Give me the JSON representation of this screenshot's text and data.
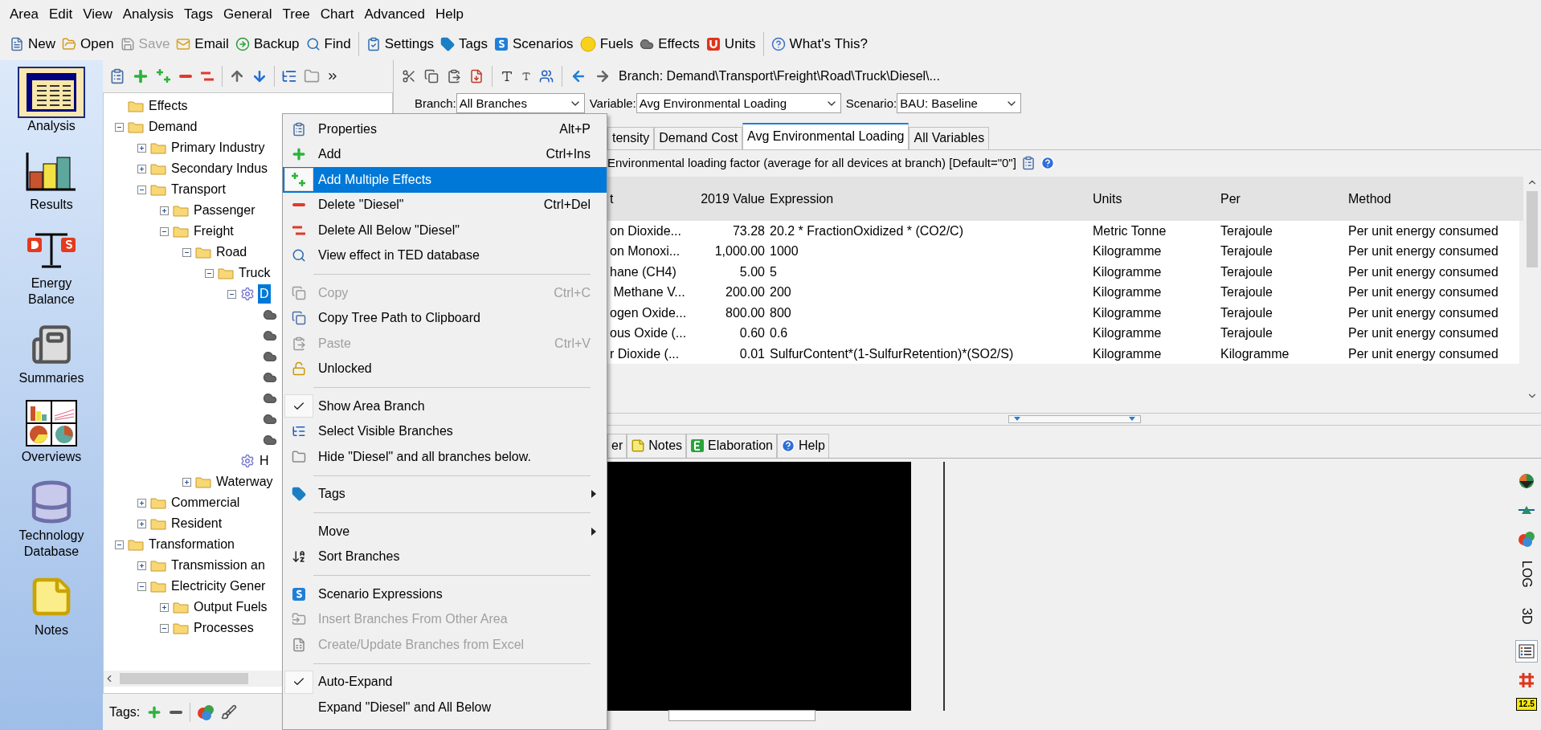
{
  "menu_bar": [
    "Area",
    "Edit",
    "View",
    "Analysis",
    "Tags",
    "General",
    "Tree",
    "Chart",
    "Advanced",
    "Help"
  ],
  "toolbar_groups": [
    [
      {
        "label": "New",
        "disabled": false
      },
      {
        "label": "Open",
        "disabled": false
      },
      {
        "label": "Save",
        "disabled": true
      },
      {
        "label": "Email",
        "disabled": false
      },
      {
        "label": "Backup",
        "disabled": false
      },
      {
        "label": "Find",
        "disabled": false
      }
    ],
    [
      {
        "label": "Settings",
        "disabled": false
      },
      {
        "label": "Tags",
        "disabled": false
      },
      {
        "label": "Scenarios",
        "disabled": false
      },
      {
        "label": "Fuels",
        "disabled": false
      },
      {
        "label": "Effects",
        "disabled": false
      },
      {
        "label": "Units",
        "disabled": false
      }
    ],
    [
      {
        "label": "What's This?",
        "disabled": false
      }
    ]
  ],
  "nav": [
    {
      "label": "Analysis",
      "selected": true
    },
    {
      "label": "Results",
      "selected": false
    },
    {
      "label": "Energy Balance",
      "selected": false
    },
    {
      "label": "Summaries",
      "selected": false
    },
    {
      "label": "Overviews",
      "selected": false
    },
    {
      "label": "Technology Database",
      "selected": false
    },
    {
      "label": "Notes",
      "selected": false
    }
  ],
  "tree": [
    {
      "kind": "folder",
      "label": "Effects",
      "selected": false
    },
    {
      "kind": "folder",
      "label": "Demand",
      "selected": false,
      "expanded": true,
      "children": [
        {
          "kind": "folder",
          "label": "Primary Industry",
          "selected": false,
          "expanded": false
        },
        {
          "kind": "folder",
          "label": "Secondary Indus",
          "selected": false,
          "expanded": false
        },
        {
          "kind": "folder",
          "label": "Transport",
          "selected": false,
          "expanded": true,
          "children": [
            {
              "kind": "folder",
              "label": "Passenger",
              "selected": false,
              "expanded": false
            },
            {
              "kind": "folder",
              "label": "Freight",
              "selected": false,
              "expanded": true,
              "children": [
                {
                  "kind": "folder",
                  "label": "Road",
                  "selected": false,
                  "expanded": true,
                  "children": [
                    {
                      "kind": "folder",
                      "label": "Truck",
                      "selected": false,
                      "expanded": true,
                      "children": [
                        {
                          "kind": "technology",
                          "label": "D",
                          "selected": true,
                          "expanded": true,
                          "children": [
                            {
                              "kind": "effect",
                              "selected": false
                            },
                            {
                              "kind": "effect",
                              "selected": false
                            },
                            {
                              "kind": "effect",
                              "selected": false
                            },
                            {
                              "kind": "effect",
                              "selected": false
                            },
                            {
                              "kind": "effect",
                              "selected": false
                            },
                            {
                              "kind": "effect",
                              "selected": false
                            },
                            {
                              "kind": "effect",
                              "selected": false
                            }
                          ]
                        },
                        {
                          "kind": "technology",
                          "label": "H",
                          "selected": false
                        }
                      ]
                    }
                  ]
                },
                {
                  "kind": "folder",
                  "label": "Waterway",
                  "selected": false,
                  "expanded": false
                }
              ]
            }
          ]
        },
        {
          "kind": "folder",
          "label": "Commercial",
          "selected": false,
          "expanded": false
        },
        {
          "kind": "folder",
          "label": "Resident",
          "selected": false,
          "expanded": false
        }
      ]
    },
    {
      "kind": "folder",
      "label": "Transformation",
      "selected": false,
      "expanded": true,
      "children": [
        {
          "kind": "folder",
          "label": "Transmission an",
          "selected": false,
          "expanded": false
        },
        {
          "kind": "folder",
          "label": "Electricity Gener",
          "selected": false,
          "expanded": true,
          "children": [
            {
              "kind": "folder",
              "label": "Output Fuels",
              "selected": false,
              "expanded": false
            },
            {
              "kind": "folder",
              "label": "Processes",
              "selected": false,
              "expanded": true
            }
          ]
        }
      ]
    }
  ],
  "tree_tags_label": "Tags:",
  "context_menu": [
    {
      "kind": "item",
      "label": "Properties",
      "shortcut": "Alt+P",
      "selected": false,
      "disabled": false,
      "checked": false
    },
    {
      "kind": "item",
      "label": "Add",
      "shortcut": "Ctrl+Ins",
      "selected": false,
      "disabled": false,
      "checked": false
    },
    {
      "kind": "item",
      "label": "Add Multiple Effects",
      "selected": true,
      "disabled": false,
      "checked": false
    },
    {
      "kind": "item",
      "label": "Delete \"Diesel\"",
      "shortcut": "Ctrl+Del",
      "selected": false,
      "disabled": false,
      "checked": false
    },
    {
      "kind": "item",
      "label": "Delete All Below \"Diesel\"",
      "selected": false,
      "disabled": false,
      "checked": false
    },
    {
      "kind": "item",
      "label": "View effect in TED database",
      "selected": false,
      "disabled": false,
      "checked": false
    },
    {
      "kind": "separator"
    },
    {
      "kind": "item",
      "label": "Copy",
      "shortcut": "Ctrl+C",
      "selected": false,
      "disabled": true,
      "checked": false
    },
    {
      "kind": "item",
      "label": "Copy Tree Path to Clipboard",
      "selected": false,
      "disabled": false,
      "checked": false
    },
    {
      "kind": "item",
      "label": "Paste",
      "shortcut": "Ctrl+V",
      "selected": false,
      "disabled": true,
      "checked": false
    },
    {
      "kind": "item",
      "label": "Unlocked",
      "selected": false,
      "disabled": false,
      "checked": false
    },
    {
      "kind": "separator"
    },
    {
      "kind": "item",
      "label": "Show Area Branch",
      "selected": false,
      "disabled": false,
      "checked": true
    },
    {
      "kind": "item",
      "label": "Select Visible Branches",
      "selected": false,
      "disabled": false,
      "checked": false
    },
    {
      "kind": "item",
      "label": "Hide \"Diesel\" and all branches below.",
      "selected": false,
      "disabled": false,
      "checked": false
    },
    {
      "kind": "separator"
    },
    {
      "kind": "submenu",
      "label": "Tags",
      "selected": false,
      "disabled": false,
      "checked": false
    },
    {
      "kind": "separator"
    },
    {
      "kind": "submenu",
      "label": "Move",
      "selected": false,
      "disabled": false,
      "checked": false
    },
    {
      "kind": "item",
      "label": "Sort Branches",
      "selected": false,
      "disabled": false,
      "checked": false
    },
    {
      "kind": "separator"
    },
    {
      "kind": "item",
      "label": "Scenario Expressions",
      "selected": false,
      "disabled": false,
      "checked": false
    },
    {
      "kind": "item",
      "label": "Insert Branches From Other Area",
      "selected": false,
      "disabled": true,
      "checked": false
    },
    {
      "kind": "item",
      "label": "Create/Update Branches from Excel",
      "selected": false,
      "disabled": true,
      "checked": false
    },
    {
      "kind": "separator"
    },
    {
      "kind": "item",
      "label": "Auto-Expand",
      "selected": false,
      "disabled": false,
      "checked": true
    },
    {
      "kind": "item",
      "label": "Expand \"Diesel\" and All Below",
      "selected": false,
      "disabled": false,
      "checked": false
    }
  ],
  "branch_path": "Branch: Demand\\Transport\\Freight\\Road\\Truck\\Diesel\\...",
  "selectors": [
    {
      "label": "Branch:",
      "value": "All Branches"
    },
    {
      "label": "Variable:",
      "value": "Avg Environmental Loading"
    },
    {
      "label": "Scenario:",
      "value": "BAU: Baseline"
    }
  ],
  "variable_tabs": [
    {
      "label": "tensity",
      "selected": false
    },
    {
      "label": "Demand Cost",
      "selected": false
    },
    {
      "label": "Avg Environmental Loading",
      "selected": true
    },
    {
      "label": "All Variables",
      "selected": false
    }
  ],
  "description": "Environmental loading factor (average for all devices at branch) [Default=\"0\"]",
  "table": {
    "columns": [
      "t",
      "2019 Value",
      "Expression",
      "Units",
      "Per",
      "Method"
    ],
    "rows": [
      [
        "on Dioxide...",
        "73.28",
        "20.2 * FractionOxidized * (CO2/C)",
        "Metric Tonne",
        "Terajoule",
        "Per unit energy consumed"
      ],
      [
        "on Monoxi...",
        "1,000.00",
        "1000",
        "Kilogramme",
        "Terajoule",
        "Per unit energy consumed"
      ],
      [
        "hane (CH4)",
        "5.00",
        "5",
        "Kilogramme",
        "Terajoule",
        "Per unit energy consumed"
      ],
      [
        " Methane V...",
        "200.00",
        "200",
        "Kilogramme",
        "Terajoule",
        "Per unit energy consumed"
      ],
      [
        "ogen Oxide...",
        "800.00",
        "800",
        "Kilogramme",
        "Terajoule",
        "Per unit energy consumed"
      ],
      [
        "ous Oxide (...",
        "0.60",
        "0.6",
        "Kilogramme",
        "Terajoule",
        "Per unit energy consumed"
      ],
      [
        "r Dioxide (...",
        "0.01",
        "SulfurContent*(1-SulfurRetention)*(SO2/S)",
        "Kilogramme",
        "Kilogramme",
        "Per unit energy consumed"
      ]
    ]
  },
  "bottom_tabs": [
    {
      "label": "er",
      "selected": false
    },
    {
      "label": "Notes",
      "selected": false
    },
    {
      "label": "Elaboration",
      "selected": false
    },
    {
      "label": "Help",
      "selected": false
    }
  ],
  "side_tools": [
    {
      "kind": "pie",
      "selected": false
    },
    {
      "kind": "balance",
      "selected": false
    },
    {
      "kind": "bubbles",
      "selected": false
    },
    {
      "kind": "text",
      "label": "LOG",
      "selected": false
    },
    {
      "kind": "text",
      "label": "3D",
      "selected": false
    },
    {
      "kind": "list",
      "selected": true
    },
    {
      "kind": "grid",
      "selected": false
    },
    {
      "kind": "badge",
      "label": "12.5",
      "selected": false
    }
  ]
}
